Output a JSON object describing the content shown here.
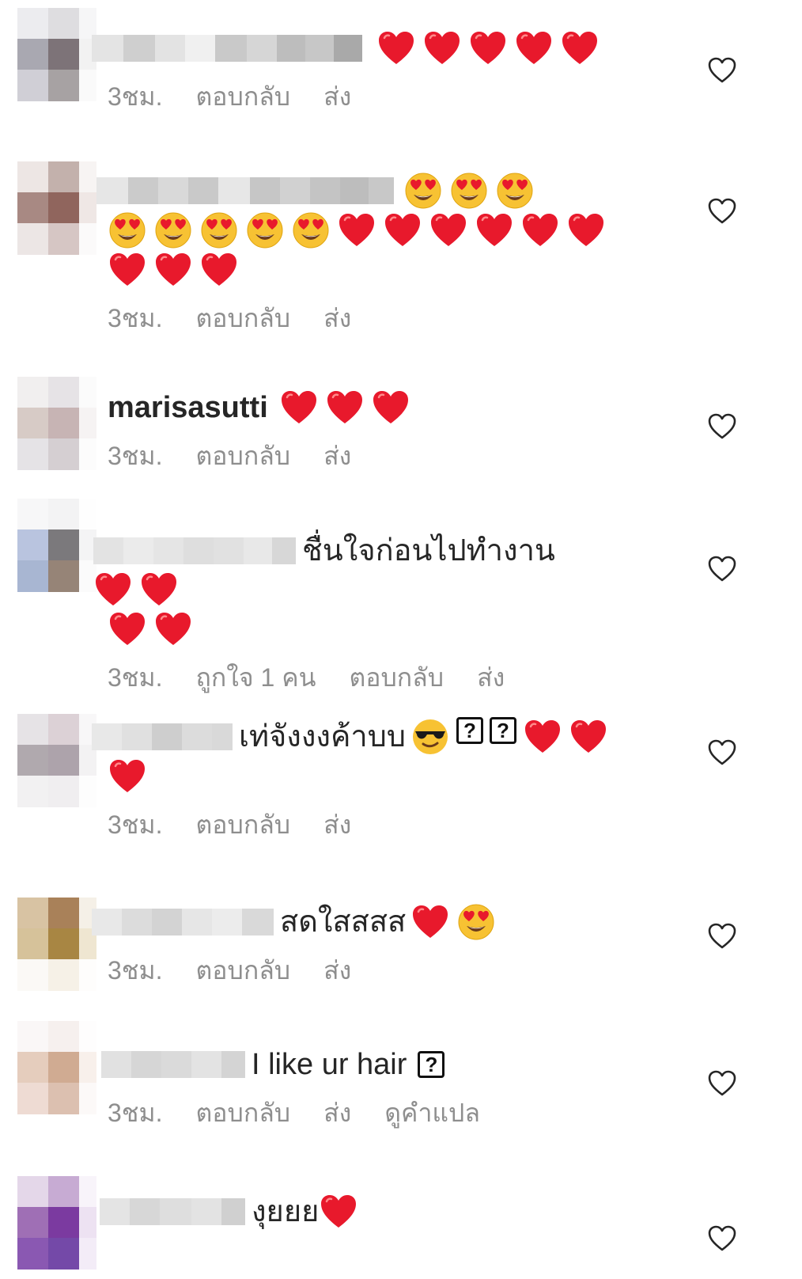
{
  "colors": {
    "meta_text": "#8e8e8e",
    "body_text": "#262626",
    "heart_red": "#e8192c"
  },
  "comments": [
    {
      "username": "",
      "text": "",
      "emojis": [
        "red-heart",
        "red-heart",
        "red-heart",
        "red-heart",
        "red-heart"
      ],
      "time": "3ชม.",
      "reply": "ตอบกลับ",
      "send": "ส่ง"
    },
    {
      "username": "",
      "text": "",
      "emojis": [
        "heart-eyes",
        "heart-eyes",
        "heart-eyes",
        "heart-eyes",
        "heart-eyes",
        "heart-eyes",
        "heart-eyes",
        "heart-eyes",
        "red-heart",
        "red-heart",
        "red-heart",
        "red-heart",
        "red-heart",
        "red-heart",
        "red-heart",
        "red-heart",
        "red-heart"
      ],
      "time": "3ชม.",
      "reply": "ตอบกลับ",
      "send": "ส่ง"
    },
    {
      "username": "marisasutti",
      "text": "",
      "emojis": [
        "red-heart",
        "red-heart",
        "red-heart"
      ],
      "time": "3ชม.",
      "reply": "ตอบกลับ",
      "send": "ส่ง"
    },
    {
      "username": "",
      "text": "ชื่นใจก่อนไปทำงาน",
      "emojis": [
        "red-heart",
        "red-heart",
        "red-heart",
        "red-heart"
      ],
      "time": "3ชม.",
      "likes": "ถูกใจ 1 คน",
      "reply": "ตอบกลับ",
      "send": "ส่ง"
    },
    {
      "username": "",
      "text": "เท่จังงงค้าบบ",
      "emojis": [
        "sunglasses-face",
        "unknown-glyph",
        "unknown-glyph",
        "red-heart",
        "red-heart",
        "red-heart"
      ],
      "time": "3ชม.",
      "reply": "ตอบกลับ",
      "send": "ส่ง"
    },
    {
      "username": "",
      "text": "สดใสสสส",
      "emojis": [
        "red-heart",
        "heart-eyes"
      ],
      "time": "3ชม.",
      "reply": "ตอบกลับ",
      "send": "ส่ง"
    },
    {
      "username": "",
      "text": "I like ur hair",
      "emojis": [
        "unknown-glyph"
      ],
      "time": "3ชม.",
      "reply": "ตอบกลับ",
      "send": "ส่ง",
      "translate": "ดูคำแปล"
    },
    {
      "username": "",
      "text": "งุยยย",
      "emojis": [
        "red-heart"
      ]
    }
  ],
  "unknown_glyph": "?"
}
